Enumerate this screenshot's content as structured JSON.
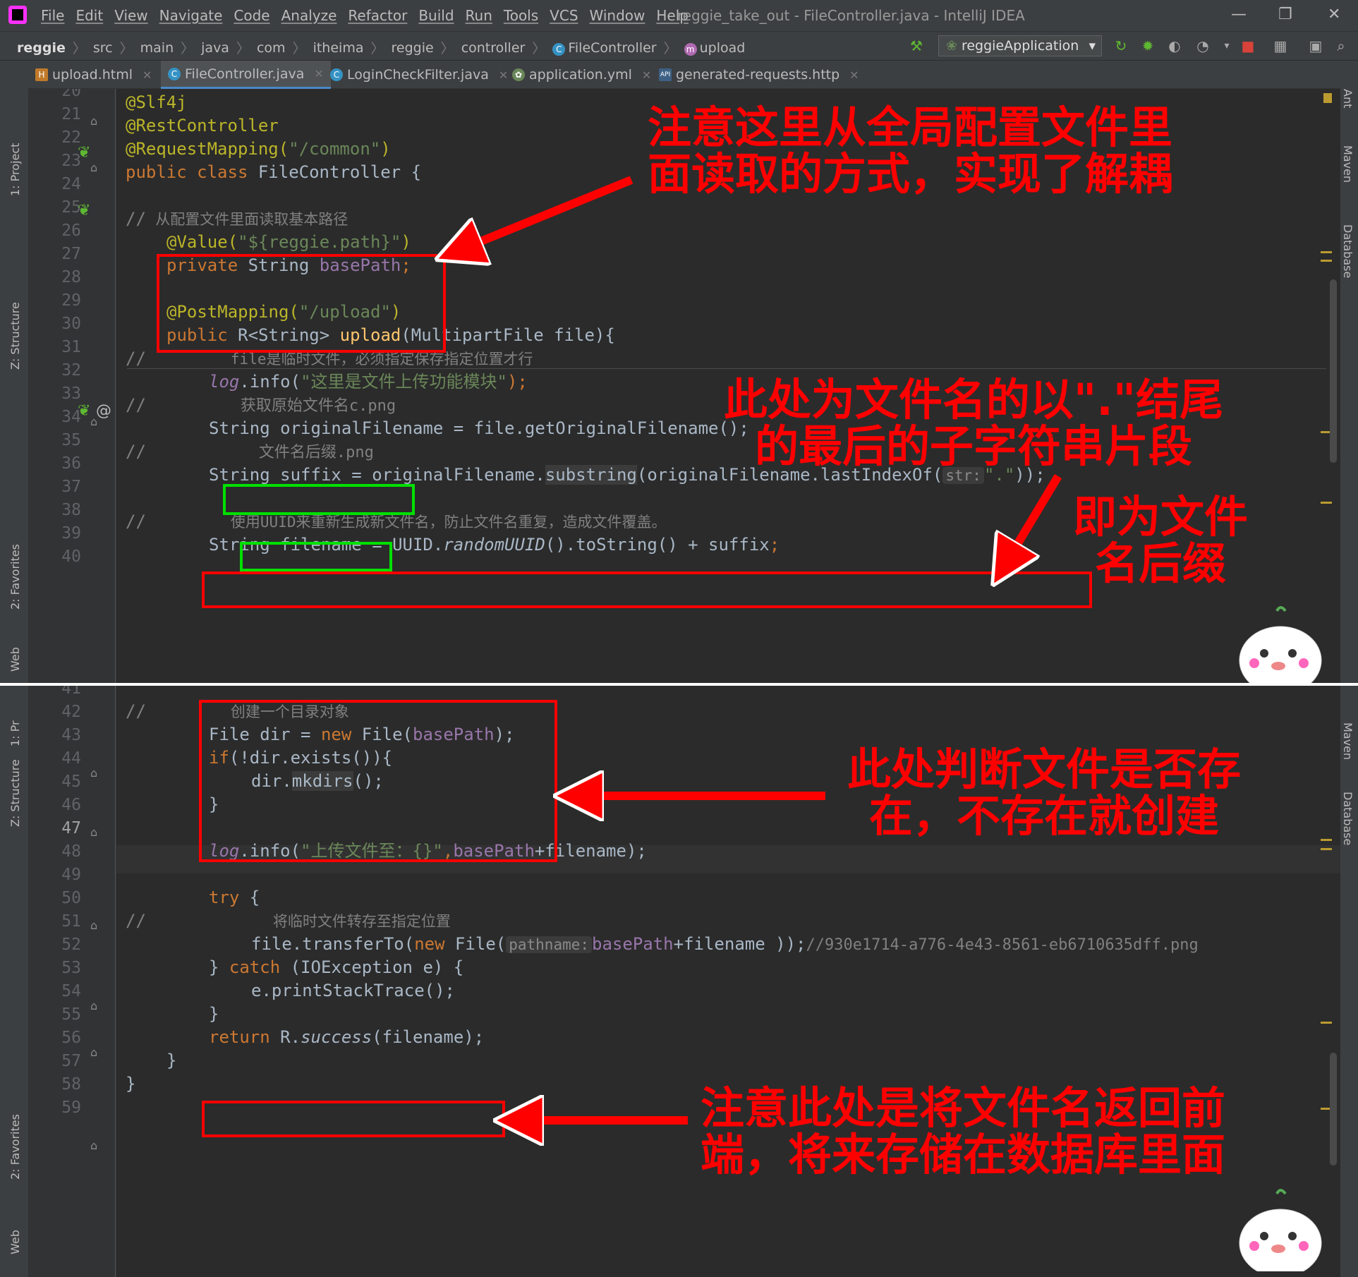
{
  "menubar": {
    "items": [
      "File",
      "Edit",
      "View",
      "Navigate",
      "Code",
      "Analyze",
      "Refactor",
      "Build",
      "Run",
      "Tools",
      "VCS",
      "Window",
      "Help"
    ],
    "title": "reggie_take_out - FileController.java - IntelliJ IDEA"
  },
  "breadcrumb": [
    "reggie",
    "src",
    "main",
    "java",
    "com",
    "itheima",
    "reggie",
    "controller",
    "FileController",
    "upload"
  ],
  "run_config": "reggieApplication",
  "tabs": [
    "upload.html",
    "FileController.java",
    "LoginCheckFilter.java",
    "application.yml",
    "generated-requests.http"
  ],
  "tool_windows": {
    "left": [
      "1: Project",
      "Z: Structure",
      "2: Favorites",
      "Web"
    ],
    "left2": [
      "1: Pr",
      "Z: Structure",
      "2: Favorites",
      "Web"
    ],
    "right": [
      "Ant",
      "Maven",
      "Database"
    ]
  },
  "colors": {
    "accent": "#4a88c7",
    "annotation_red": "#ff0000",
    "annotation_green": "#00e000",
    "editor_bg": "#2b2b2b"
  },
  "line_numbers_top": [
    "20",
    "21",
    "22",
    "23",
    "24",
    "25",
    "26",
    "27",
    "28",
    "29",
    "30",
    "31",
    "32",
    "33",
    "34",
    "35",
    "36",
    "37",
    "38",
    "39",
    "40"
  ],
  "line_numbers_bottom": [
    "41",
    "42",
    "43",
    "44",
    "45",
    "46",
    "47",
    "48",
    "49",
    "50",
    "51",
    "52",
    "53",
    "54",
    "55",
    "56",
    "57",
    "58",
    "59"
  ],
  "code": {
    "l21": "@Slf4j",
    "l22": "@RestController",
    "l23a": "@RequestMapping(",
    "l23b": "\"/common\"",
    "l23c": ")",
    "l24a": "public class ",
    "l24b": "FileController {",
    "l26a": "//",
    "l26b": "  从配置文件里面读取基本路径",
    "l27a": "@Value(",
    "l27b": "\"${reggie.path}\"",
    "l27c": ")",
    "l28a": "private ",
    "l28b": "String ",
    "l28c": "basePath",
    "l28d": ";",
    "l30a": "@PostMapping(",
    "l30b": "\"/upload\"",
    "l30c": ")",
    "l31a": "public ",
    "l31b": "R<String> ",
    "l31c": "upload",
    "l31d": "(MultipartFile file){",
    "l32a": "//",
    "l32b": "file是临时文件，必须指定保存指定位置才行",
    "l33a": "log",
    "l33b": ".info(",
    "l33c": "\"这里是文件上传功能模块\"",
    "l33d": ");",
    "l34a": "//",
    "l34b": "获取原始文件名c.png",
    "l35": "String originalFilename = file.getOriginalFilename();",
    "l36a": "//",
    "l36b": "文件名后缀.png",
    "l37a": "String suffix = originalFilename.",
    "l37b": "substring",
    "l37c": "(originalFilename.lastIndexOf(",
    "l37hint": "str:",
    "l37d": "\".\"",
    "l37e": "));",
    "l39a": "//",
    "l39b": "使用UUID来重新生成新文件名，防止文件名重复，造成文件覆盖。",
    "l40a": "String filename = UUID.",
    "l40b": "randomUUID",
    "l40c": "().toString() + suffix",
    "l40d": ";",
    "l42a": "//",
    "l42b": "创建一个目录对象",
    "l43a": "File dir = ",
    "l43b": "new ",
    "l43c": "File(",
    "l43d": "basePath",
    "l43e": ");",
    "l44a": "if",
    "l44b": "(!dir.exists()){",
    "l45a": "dir.",
    "l45b": "mkdirs",
    "l45c": "();",
    "l46": "}",
    "l48a": "log",
    "l48b": ".info(",
    "l48c": "\"上传文件至：{}\"",
    "l48d": ",",
    "l48e": "basePath",
    "l48f": "+filename);",
    "l50a": "try ",
    "l50b": "{",
    "l51a": "//",
    "l51b": "将临时文件转存至指定位置",
    "l52a": "file.transferTo(",
    "l52b": "new ",
    "l52c": "File(",
    "l52hint": "pathname:",
    "l52d": "basePath",
    "l52e": "+filename ));",
    "l52f": "//930e1714-a776-4e43-8561-eb6710635dff.png",
    "l53a": "} ",
    "l53b": "catch ",
    "l53c": "(IOException e) {",
    "l54": "e.printStackTrace();",
    "l55": "}",
    "l56a": "return ",
    "l56b": "R.",
    "l56c": "success",
    "l56d": "(filename);",
    "l57": "}",
    "l58": "}"
  },
  "notes": {
    "n1": "注意这里从全局配置文件里面读取的方式，实现了解耦",
    "n2": "此处为文件名的以\".\"结尾的最后的子字符串片段",
    "n3": "即为文件名后缀",
    "n4": "此处判断文件是否存在，不存在就创建",
    "n5": "注意此处是将文件名返回前端，将来存储在数据库里面"
  }
}
